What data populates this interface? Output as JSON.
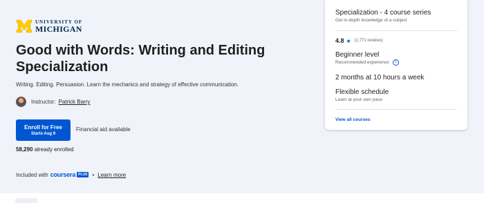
{
  "logo": {
    "line1": "UNIVERSITY OF",
    "line2": "MICHIGAN",
    "icon": "university-m-logo",
    "colors": {
      "maize": "#ffcb05",
      "blue": "#00274c"
    }
  },
  "course": {
    "title": "Good with Words: Writing and Editing Specialization",
    "description": "Writing. Editing. Persuasion. Learn the mechanics and strategy of effective communication."
  },
  "instructor": {
    "label": "Instructor:",
    "name": "Patrick Barry"
  },
  "enroll": {
    "label": "Enroll for Free",
    "sub": "Starts Aug 9",
    "financial_aid": "Financial aid available"
  },
  "enrolled": {
    "count": "58,290",
    "text": "already enrolled"
  },
  "included": {
    "prefix": "Included with",
    "brand": "coursera",
    "badge": "PLUS",
    "separator": "•",
    "link": "Learn more"
  },
  "card": {
    "series": {
      "title": "Specialization - 4 course series",
      "sub": "Get in-depth knowledge of a subject"
    },
    "rating": {
      "value": "4.8",
      "icon": "star-icon",
      "reviews": "(1,771 reviews)"
    },
    "level": {
      "title": "Beginner level",
      "sub": "Recommended experience",
      "icon": "info-icon"
    },
    "duration": {
      "title": "2 months at 10 hours a week"
    },
    "schedule": {
      "title": "Flexible schedule",
      "sub": "Learn at your own pace"
    },
    "view_all": "View all courses"
  },
  "colors": {
    "accent": "#0056d2",
    "hero_bg": "#f0f4fa"
  }
}
